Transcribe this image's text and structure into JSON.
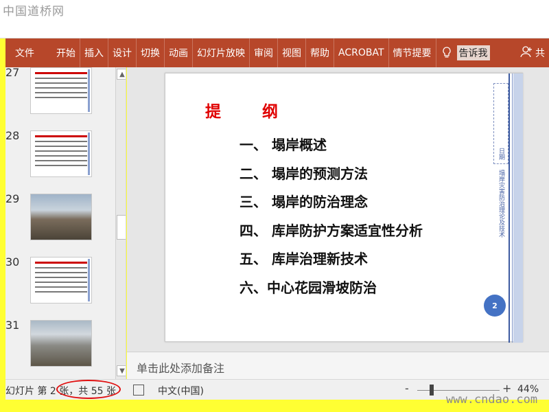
{
  "watermark_top": "中国道桥网",
  "watermark_bottom": "www.cndao.com",
  "ribbon": {
    "tabs": [
      "文件",
      "开始",
      "插入",
      "设计",
      "切换",
      "动画",
      "幻灯片放映",
      "审阅",
      "视图",
      "帮助",
      "ACROBAT",
      "情节提要"
    ],
    "tell_me": "告诉我",
    "share": "共"
  },
  "thumbnails": [
    {
      "num": "27",
      "kind": "text"
    },
    {
      "num": "28",
      "kind": "text"
    },
    {
      "num": "29",
      "kind": "photo"
    },
    {
      "num": "30",
      "kind": "text"
    },
    {
      "num": "31",
      "kind": "photo"
    }
  ],
  "slide": {
    "title": "提 纲",
    "items": [
      "一、 塌岸概述",
      "二、 塌岸的预测方法",
      "三、 塌岸的防治理念",
      "四、 库岸防护方案适宜性分析",
      "五、 库岸治理新技术",
      "六、中心花园滑坡防治"
    ],
    "side_label_1": "日期",
    "side_label_2": "塌岸灾害防治理论及技术",
    "page_number": "2"
  },
  "notes_placeholder": "单击此处添加备注",
  "status": {
    "slide_info": "幻灯片 第 2 张，共 55 张",
    "language": "中文(中国)",
    "zoom": "44%",
    "zoom_minus": "-",
    "zoom_plus": "+"
  },
  "colors": {
    "ribbon": "#b7472a",
    "title_red": "#e00000",
    "accent_blue": "#4472c4"
  }
}
